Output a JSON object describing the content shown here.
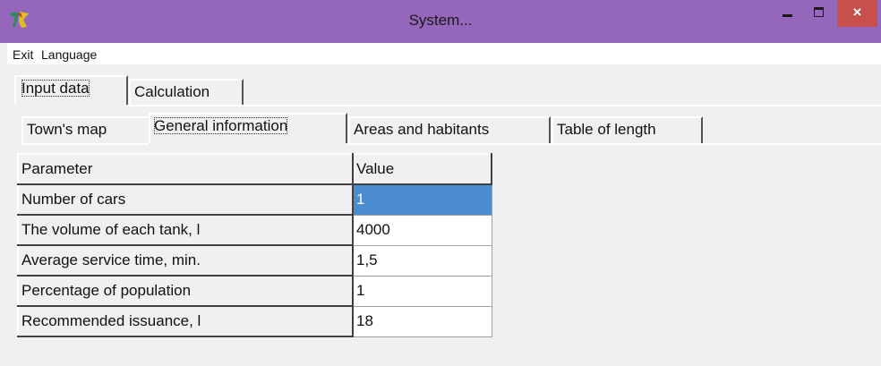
{
  "window": {
    "title": "System...",
    "close_label": "×"
  },
  "menu": [
    "Exit",
    "Language"
  ],
  "outer_tabs": [
    {
      "label": "Input data"
    },
    {
      "label": "Calculation"
    }
  ],
  "inner_tabs": [
    {
      "label": "Town's map"
    },
    {
      "label": "General information"
    },
    {
      "label": "Areas and habitants"
    },
    {
      "label": "Table of length"
    }
  ],
  "table": {
    "headers": [
      "Parameter",
      "Value"
    ],
    "rows": [
      {
        "parameter": "Number of cars",
        "value": "1"
      },
      {
        "parameter": "The volume of each tank, l",
        "value": "4000"
      },
      {
        "parameter": "Average service time, min.",
        "value": "1,5"
      },
      {
        "parameter": "Percentage of population",
        "value": "1"
      },
      {
        "parameter": "Recommended issuance, l",
        "value": "18"
      }
    ]
  },
  "colors": {
    "titlebar": "#9467bb",
    "close_button": "#c7504c",
    "selected_cell": "#4b8bd0"
  }
}
